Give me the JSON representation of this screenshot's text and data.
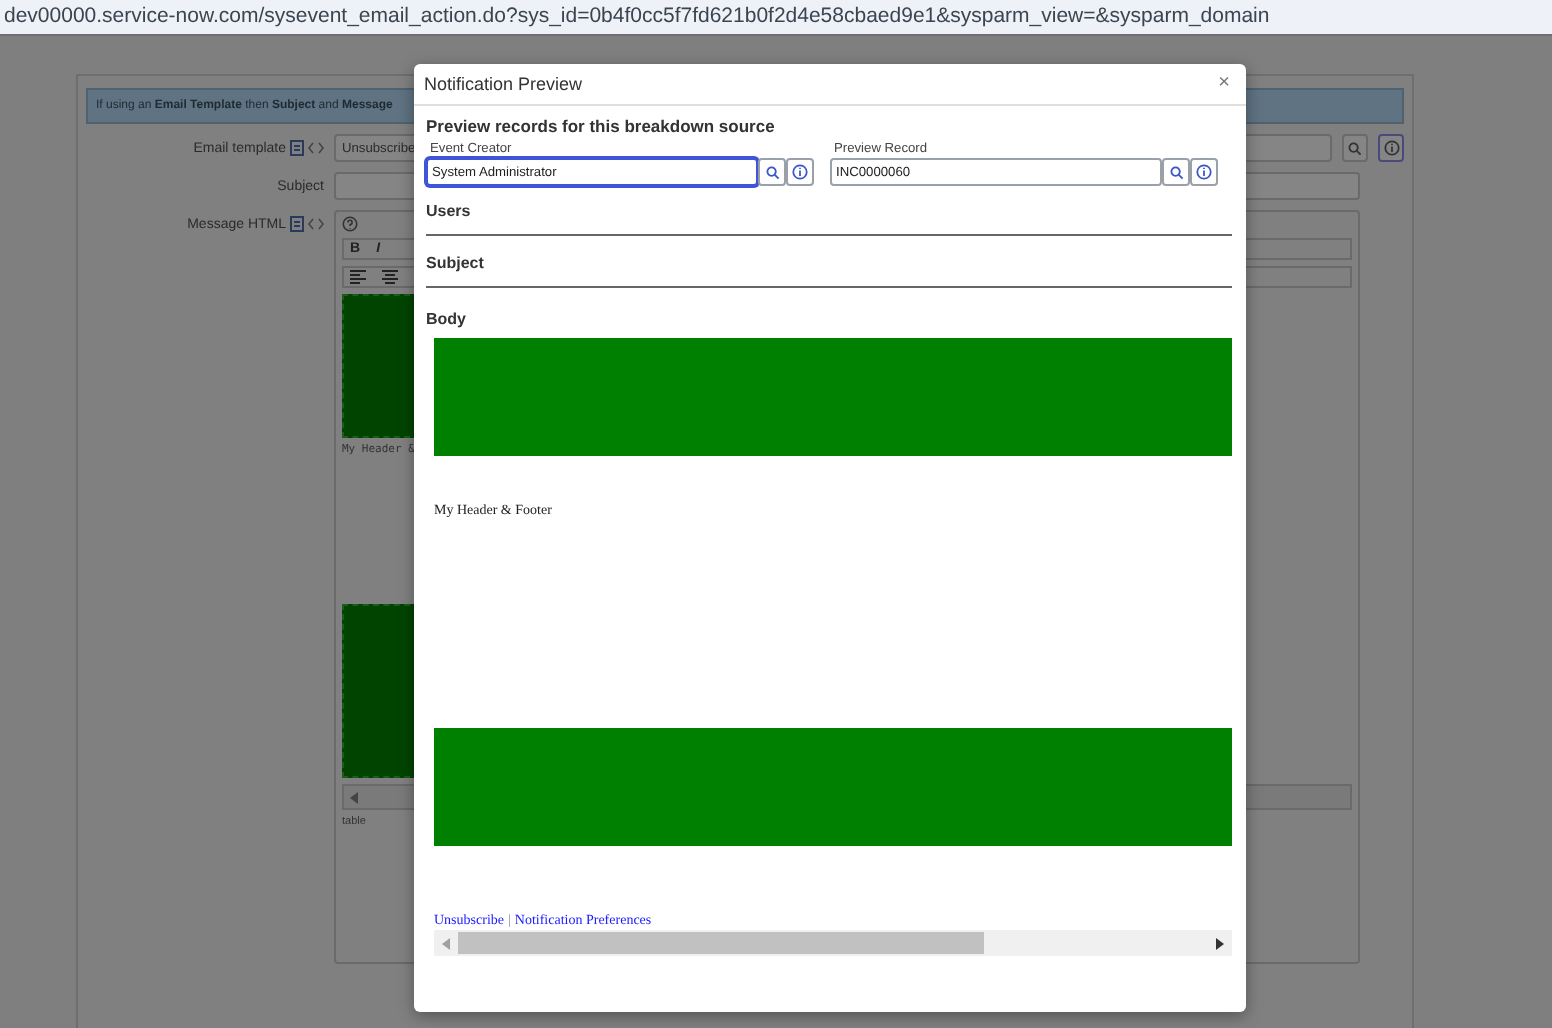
{
  "address_bar": {
    "url": "dev00000.service-now.com/sysevent_email_action.do?sys_id=0b4f0cc5f7fd621b0f2d4e58cbaed9e1&sysparm_view=&sysparm_domain"
  },
  "background_form": {
    "banner": {
      "text": "If using an **Email Template** then **Subject** and **Message**"
    },
    "fields": [
      {
        "kind": "lookup",
        "label": "Email template",
        "value": "Unsubscribe"
      },
      {
        "kind": "text",
        "label": "Subject"
      },
      {
        "kind": "editor",
        "label": "Message HTML"
      }
    ],
    "editor": {
      "toolbar": [
        "B",
        "I"
      ],
      "content_text": "My Header &",
      "status": "table"
    }
  },
  "dialog": {
    "title": "Notification Preview",
    "close": "×",
    "heading": "Preview records for this breakdown source",
    "fields": [
      {
        "label": "Event Creator",
        "value": "System Administrator",
        "focused": true
      },
      {
        "label": "Preview Record",
        "value": "INC0000060",
        "focused": false
      }
    ],
    "sections": [
      {
        "title": "Users"
      },
      {
        "title": "Subject"
      }
    ],
    "body": {
      "title": "Body",
      "footer_text": "My Header & Footer",
      "links": [
        "Unsubscribe",
        "Notification Preferences"
      ],
      "separator": "|"
    }
  }
}
